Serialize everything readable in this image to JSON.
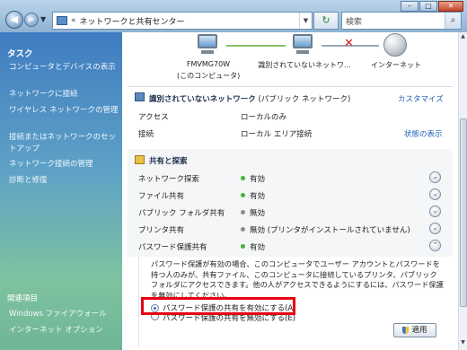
{
  "address": {
    "path": "ネットワークと共有センター",
    "prefix": "«"
  },
  "search": {
    "placeholder": "検索"
  },
  "window_controls": {
    "minimize": "–",
    "maximize": "□",
    "close": "✕"
  },
  "sidebar": {
    "tasks_title": "タスク",
    "items": [
      "コンピュータとデバイスの表示",
      "ネットワークに接続",
      "ワイヤレス ネットワークの管理",
      "接続またはネットワークのセットアップ",
      "ネットワーク接続の管理",
      "診断と修復"
    ],
    "related_title": "関連項目",
    "related_items": [
      "Windows ファイアウォール",
      "インターネット オプション"
    ]
  },
  "map": {
    "computer_name": "FMVMG70W",
    "computer_sub": "(このコンピュータ)",
    "network_label": "識別されていないネットワ...",
    "internet_label": "インターネット"
  },
  "network": {
    "title": "識別されていないネットワーク",
    "type": "(パブリック ネットワーク)",
    "customize_link": "カスタマイズ",
    "access_label": "アクセス",
    "access_value": "ローカルのみ",
    "connection_label": "接続",
    "connection_value": "ローカル エリア接続",
    "status_link": "状態の表示"
  },
  "sharing": {
    "title": "共有と探索",
    "rows": [
      {
        "label": "ネットワーク探索",
        "value": "有効",
        "status": "on"
      },
      {
        "label": "ファイル共有",
        "value": "有効",
        "status": "on"
      },
      {
        "label": "パブリック フォルダ共有",
        "value": "無効",
        "status": "off"
      },
      {
        "label": "プリンタ共有",
        "value": "無効 (プリンタがインストールされていません)",
        "status": "off"
      },
      {
        "label": "パスワード保護共有",
        "value": "有効",
        "status": "on"
      }
    ]
  },
  "password_section": {
    "description": "パスワード保護が有効の場合、このコンピュータでユーザー アカウントとパスワードを持つ人のみが、共有ファイル、このコンピュータに接続しているプリンタ、パブリック フォルダにアクセスできます。他の人がアクセスできるようにするには、パスワード保護を無効にしてください。",
    "option_on": "パスワード保護の共有を有効にする(A)",
    "option_off": "パスワード保護の共有を無効にする(E)",
    "selected": "on",
    "apply_label": "適用"
  },
  "colors": {
    "highlight": "#e60012",
    "link": "#1e5fb8",
    "status_on": "#4bb03b"
  }
}
